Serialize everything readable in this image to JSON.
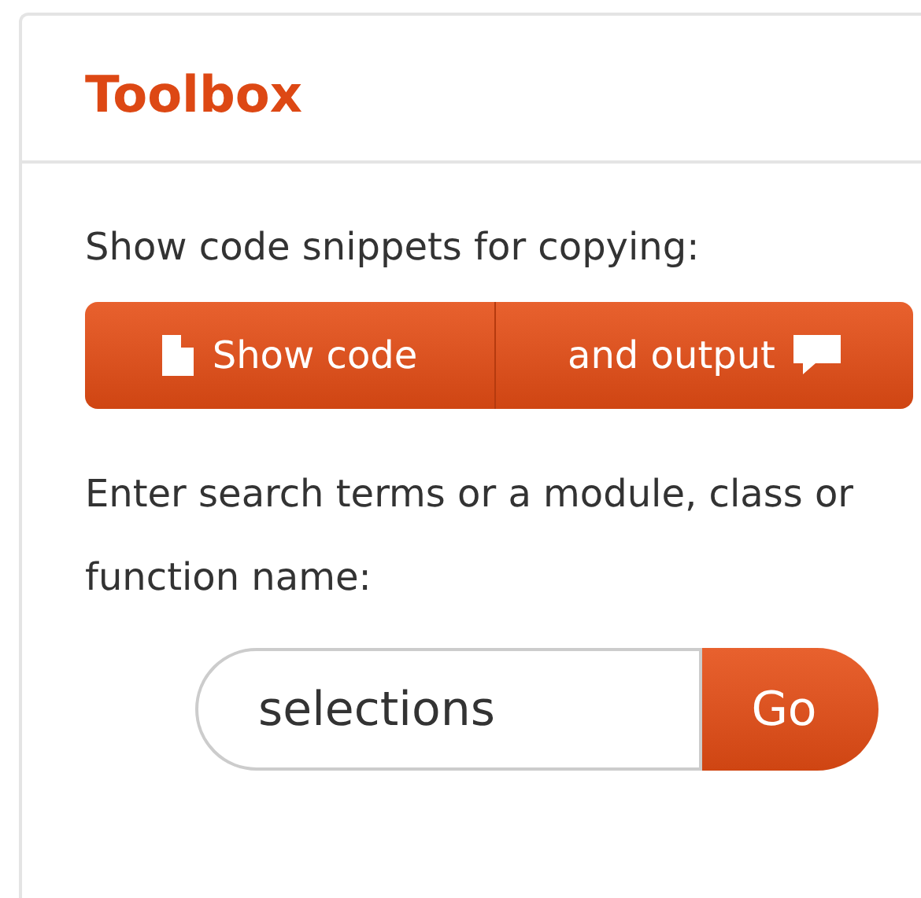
{
  "toolbox": {
    "title": "Toolbox",
    "snippets_label": "Show code snippets for copying:",
    "buttons": [
      {
        "label": "Show code",
        "kind": "code"
      },
      {
        "label": "and output",
        "kind": "output"
      }
    ],
    "search_label": "Enter search terms or a module, class or function name:",
    "search": {
      "value": "selections",
      "button": "Go"
    }
  }
}
